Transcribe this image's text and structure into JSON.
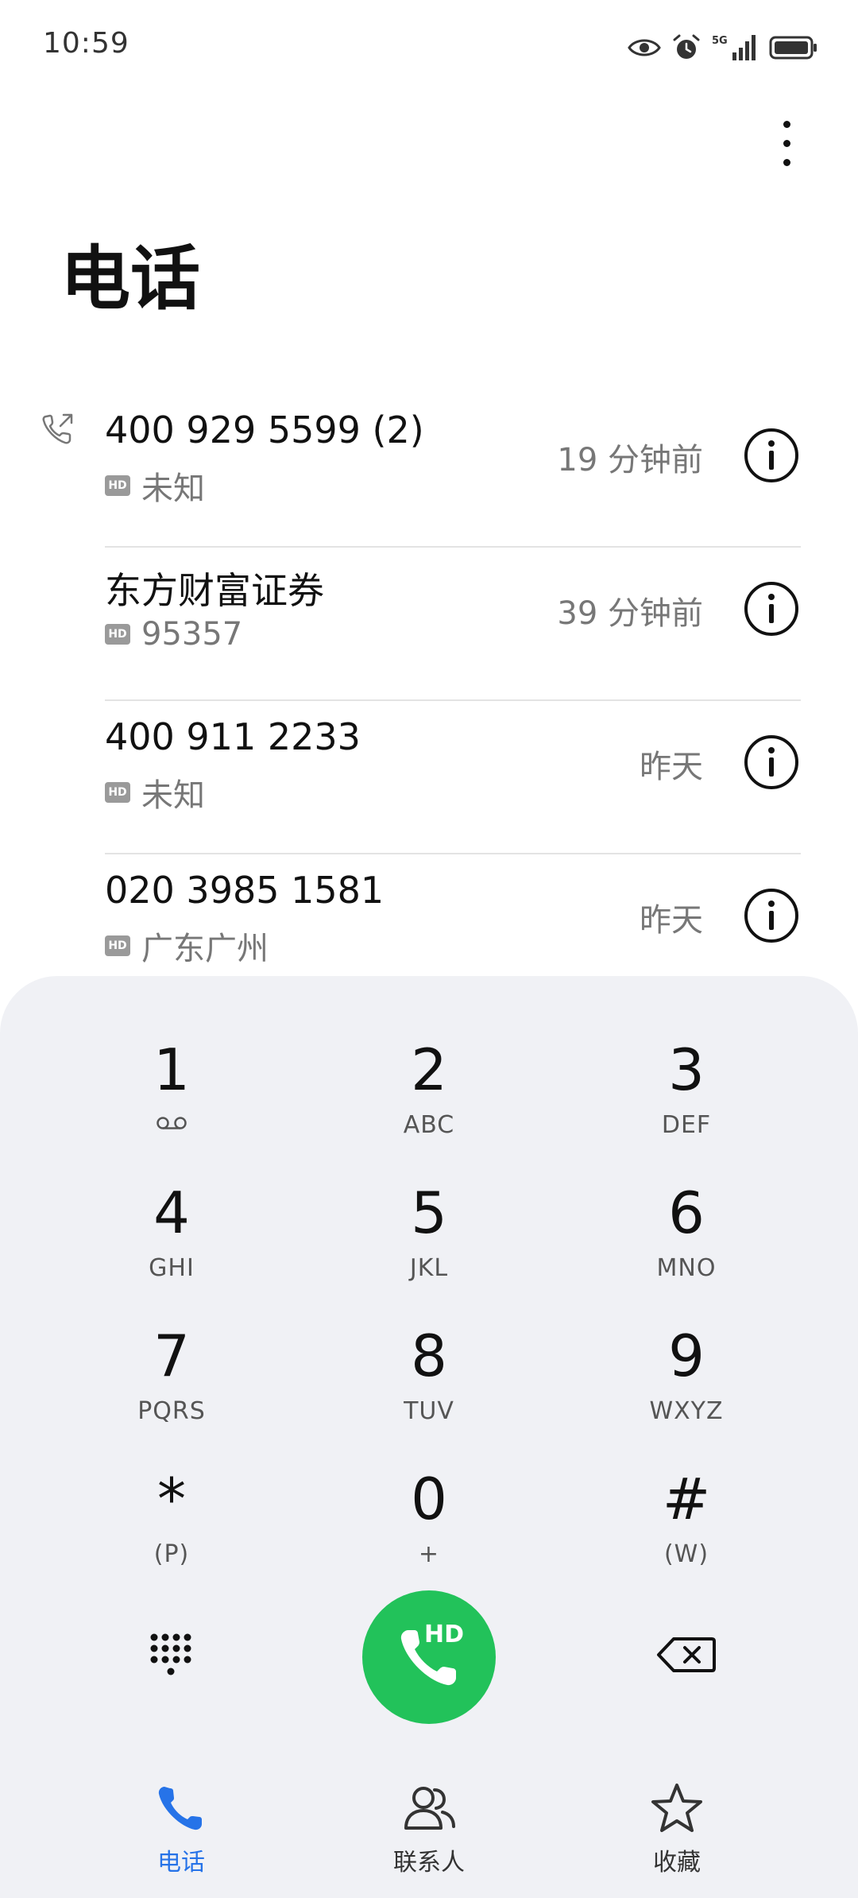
{
  "status_bar": {
    "time": "10:59",
    "icons": [
      "eye-icon",
      "alarm-icon",
      "signal-5g-icon",
      "battery-icon"
    ],
    "network_label": "5G"
  },
  "header": {
    "title": "电话",
    "more_icon": "more-vertical-icon"
  },
  "calls": [
    {
      "name": "400 929 5599 (2)",
      "badge": "HD",
      "location": "未知",
      "time": "19 分钟前",
      "type_icon": "outgoing-call-icon"
    },
    {
      "name": "东方财富证券",
      "badge": "HD",
      "location": "95357",
      "time": "39 分钟前"
    },
    {
      "name": "400 911 2233",
      "badge": "HD",
      "location": "未知",
      "time": "昨天"
    },
    {
      "name": "020 3985 1581",
      "badge": "HD",
      "location": "广东广州",
      "time": "昨天"
    }
  ],
  "dialpad": {
    "keys": [
      {
        "digit": "1",
        "letters": ""
      },
      {
        "digit": "2",
        "letters": "ABC"
      },
      {
        "digit": "3",
        "letters": "DEF"
      },
      {
        "digit": "4",
        "letters": "GHI"
      },
      {
        "digit": "5",
        "letters": "JKL"
      },
      {
        "digit": "6",
        "letters": "MNO"
      },
      {
        "digit": "7",
        "letters": "PQRS"
      },
      {
        "digit": "8",
        "letters": "TUV"
      },
      {
        "digit": "9",
        "letters": "WXYZ"
      },
      {
        "digit": "*",
        "letters": "(P)"
      },
      {
        "digit": "0",
        "letters": "+"
      },
      {
        "digit": "#",
        "letters": "(W)"
      }
    ],
    "call_button_label": "HD",
    "call_button_color": "#22c25a"
  },
  "bottom_nav": {
    "items": [
      {
        "label": "电话",
        "icon": "phone-icon",
        "active": true
      },
      {
        "label": "联系人",
        "icon": "contacts-icon",
        "active": false
      },
      {
        "label": "收藏",
        "icon": "star-icon",
        "active": false
      }
    ],
    "active_color": "#2673e8"
  }
}
